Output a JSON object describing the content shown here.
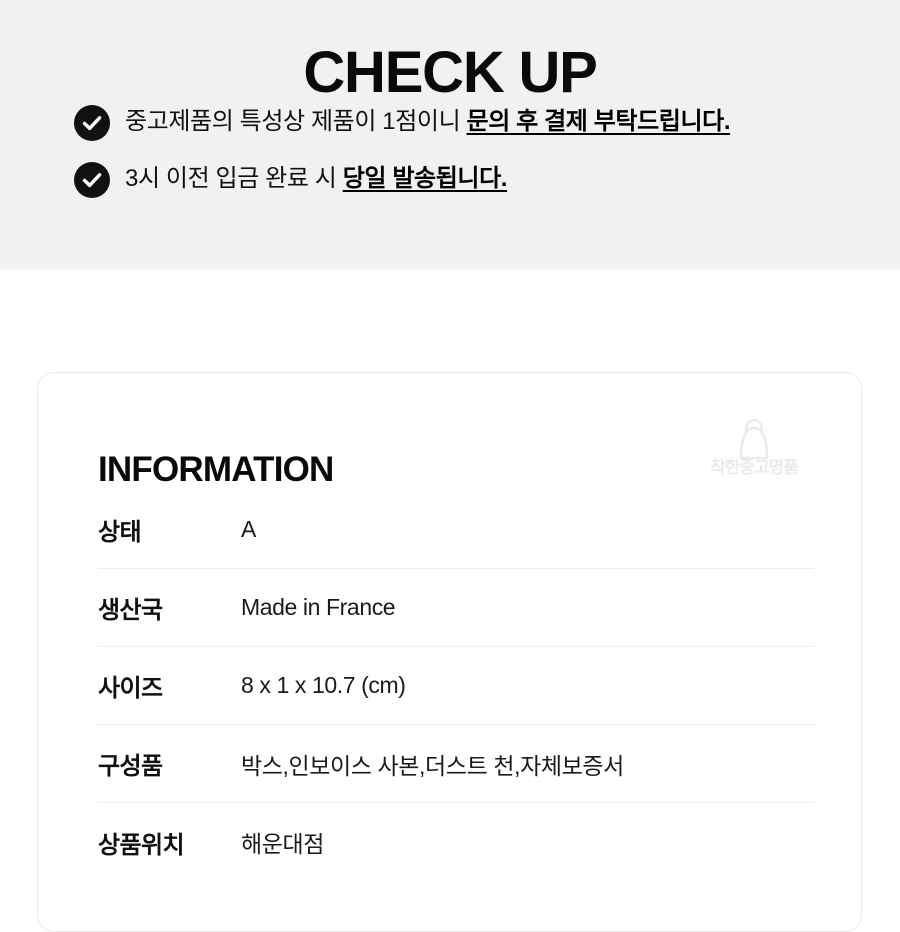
{
  "checkup": {
    "title": "CHECK UP",
    "bullets": [
      {
        "icon": "check-circle-icon",
        "text_normal": "중고제품의 특성상 제품이 1점이니 ",
        "text_emphasis": "문의 후 결제 부탁드립니다."
      },
      {
        "icon": "check-circle-icon",
        "text_normal": "3시 이전 입금 완료 시 ",
        "text_emphasis": "당일 발송됩니다."
      }
    ]
  },
  "information": {
    "heading": "INFORMATION",
    "watermark": {
      "icon": "shopping-bag-icon",
      "text": "착한중고명품"
    },
    "rows": [
      {
        "label": "상태",
        "value": "A"
      },
      {
        "label": "생산국",
        "value": "Made in France"
      },
      {
        "label": "사이즈",
        "value": "8 x 1 x 10.7 (cm)"
      },
      {
        "label": "구성품",
        "value": "박스,인보이스 사본,더스트 천,자체보증서"
      },
      {
        "label": "상품위치",
        "value": "해운대점"
      }
    ]
  },
  "colors": {
    "banner_background": "#f1f1f1",
    "page_background": "#ffffff",
    "text_primary": "#111111",
    "accent": "#000000",
    "divider": "#ededed",
    "card_border": "#e9e9e9"
  }
}
